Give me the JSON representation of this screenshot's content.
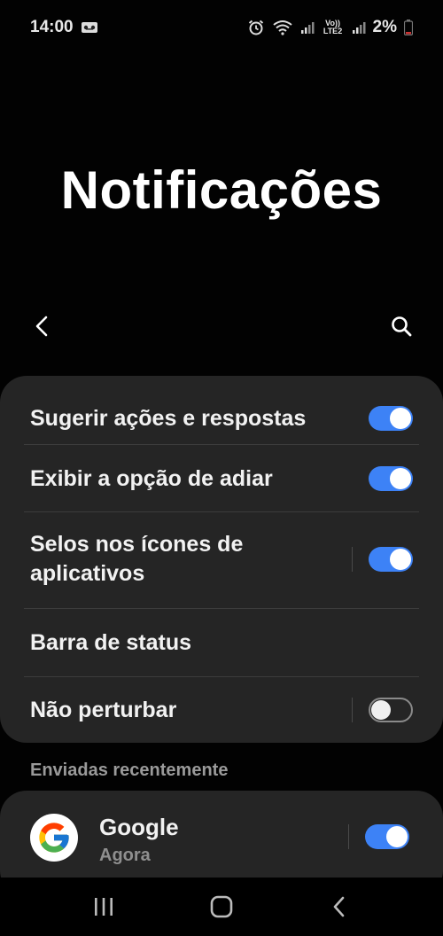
{
  "status_bar": {
    "time": "14:00",
    "network_lte": "Vo)) LTE2",
    "battery": "2%"
  },
  "page": {
    "title": "Notificações"
  },
  "settings": [
    {
      "label": "Sugerir ações e respostas",
      "toggle": "on"
    },
    {
      "label": "Exibir a opção de adiar",
      "toggle": "on"
    },
    {
      "label": "Selos nos ícones de aplicativos",
      "toggle": "on"
    },
    {
      "label": "Barra de status"
    },
    {
      "label": "Não perturbar",
      "toggle": "off"
    }
  ],
  "recent": {
    "header": "Enviadas recentemente",
    "apps": [
      {
        "name": "Google",
        "time": "Agora",
        "toggle": "on",
        "icon": "google-icon"
      }
    ]
  },
  "colors": {
    "accent": "#3d82f6",
    "card": "#252525",
    "background": "#020202"
  },
  "icons": {
    "back": "chevron-left-icon",
    "search": "search-icon",
    "nav_recents": "recents-icon",
    "nav_home": "home-icon",
    "nav_back": "back-icon"
  }
}
